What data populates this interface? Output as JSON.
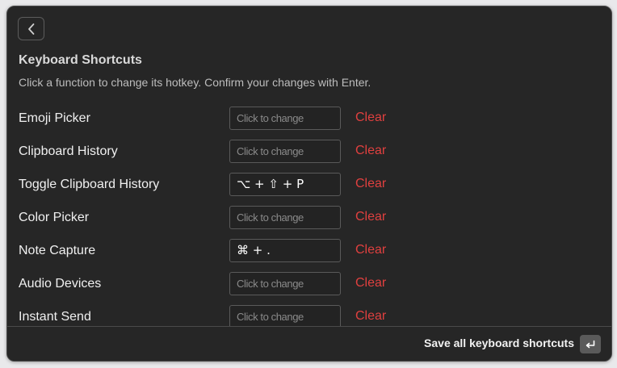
{
  "header": {
    "back_icon": "chevron-left-icon",
    "title": "Keyboard Shortcuts",
    "subtitle": "Click a function to change its hotkey. Confirm your changes with Enter."
  },
  "shortcuts": [
    {
      "label": "Emoji Picker",
      "placeholder": "Click to change",
      "value": "",
      "clear_label": "Clear"
    },
    {
      "label": "Clipboard History",
      "placeholder": "Click to change",
      "value": "",
      "clear_label": "Clear"
    },
    {
      "label": "Toggle Clipboard History",
      "placeholder": "Click to change",
      "value": "⌥ + ⇧ + P",
      "clear_label": "Clear"
    },
    {
      "label": "Color Picker",
      "placeholder": "Click to change",
      "value": "",
      "clear_label": "Clear"
    },
    {
      "label": "Note Capture",
      "placeholder": "Click to change",
      "value": "⌘ + .",
      "clear_label": "Clear"
    },
    {
      "label": "Audio Devices",
      "placeholder": "Click to change",
      "value": "",
      "clear_label": "Clear"
    },
    {
      "label": "Instant Send",
      "placeholder": "Click to change",
      "value": "",
      "clear_label": "Clear"
    }
  ],
  "footer": {
    "save_label": "Save all keyboard shortcuts",
    "enter_icon": "return-key-icon"
  },
  "colors": {
    "background": "#262626",
    "clear": "#e0403f",
    "text": "#f0f0f0"
  }
}
